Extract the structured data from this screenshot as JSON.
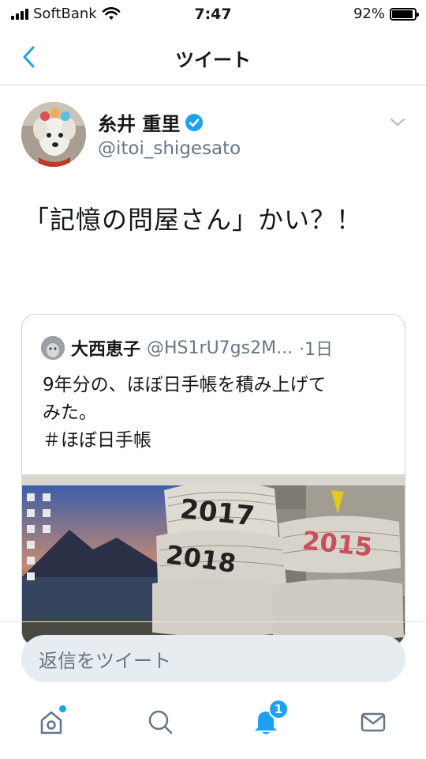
{
  "status_bar": {
    "carrier": "SoftBank",
    "time": "7:47",
    "battery": "92%",
    "battery_level": 0.92
  },
  "nav": {
    "title": "ツイート",
    "back_icon": "chevron-left-icon"
  },
  "tweet": {
    "author_name": "糸井 重里",
    "author_handle": "@itoi_shigesato",
    "verified": true,
    "text": "「記憶の問屋さん」かい？！"
  },
  "quoted_tweet": {
    "author_name": "大西恵子",
    "author_handle": "@HS1rU7gs2M...",
    "time": "·1日",
    "line1": "9年分の、ほぼ日手帳を積み上げて",
    "line2": "みた。",
    "line3": "＃ほぼ日手帳",
    "image_labels": [
      "2017",
      "2018",
      "2015"
    ]
  },
  "reply": {
    "placeholder": "返信をツイート"
  },
  "tab_bar": {
    "items": [
      "home-icon",
      "search-icon",
      "notifications-icon",
      "messages-icon"
    ],
    "notification_count": "1"
  },
  "colors": {
    "accent": "#1da1f2",
    "secondary_text": "#657786"
  }
}
